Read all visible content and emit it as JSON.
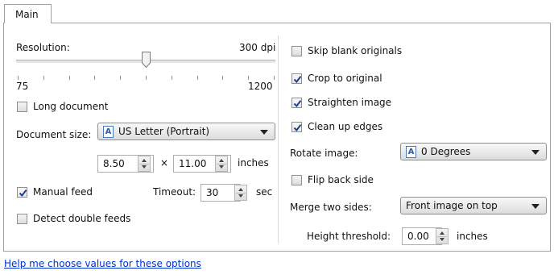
{
  "tabs": [
    {
      "label": "Main"
    }
  ],
  "left": {
    "resolution_label": "Resolution:",
    "resolution_value": "300 dpi",
    "resolution_min": "75",
    "resolution_max": "1200",
    "resolution_level": 0.5,
    "long_document": {
      "label": "Long document",
      "checked": false
    },
    "document_size_label": "Document size:",
    "document_size_value": "US Letter (Portrait)",
    "width_value": "8.50",
    "times_symbol": "×",
    "height_value": "11.00",
    "units": "inches",
    "manual_feed": {
      "label": "Manual feed",
      "checked": true
    },
    "timeout_label": "Timeout:",
    "timeout_value": "30",
    "timeout_units": "sec",
    "detect_double_feeds": {
      "label": "Detect double feeds",
      "checked": false
    }
  },
  "right": {
    "skip_blank": {
      "label": "Skip blank originals",
      "checked": false
    },
    "crop": {
      "label": "Crop to original",
      "checked": true
    },
    "straighten": {
      "label": "Straighten image",
      "checked": true
    },
    "clean_edges": {
      "label": "Clean up edges",
      "checked": true
    },
    "rotate_label": "Rotate image:",
    "rotate_value": "0 Degrees",
    "flip_back": {
      "label": "Flip back side",
      "checked": false
    },
    "merge_label": "Merge two sides:",
    "merge_value": "Front image on top",
    "height_threshold_label": "Height threshold:",
    "height_threshold_value": "0.00",
    "height_threshold_units": "inches"
  },
  "help_link": "Help me choose values for these options",
  "icons": {
    "document": "document-orientation-icon",
    "checkmark": "checkmark-icon",
    "dropdown": "chevron-down-icon",
    "spinner": "spinner-arrows-icon"
  },
  "colors": {
    "link": "#0033cc",
    "check": "#1a3f8f",
    "border": "#a0a0a0"
  }
}
